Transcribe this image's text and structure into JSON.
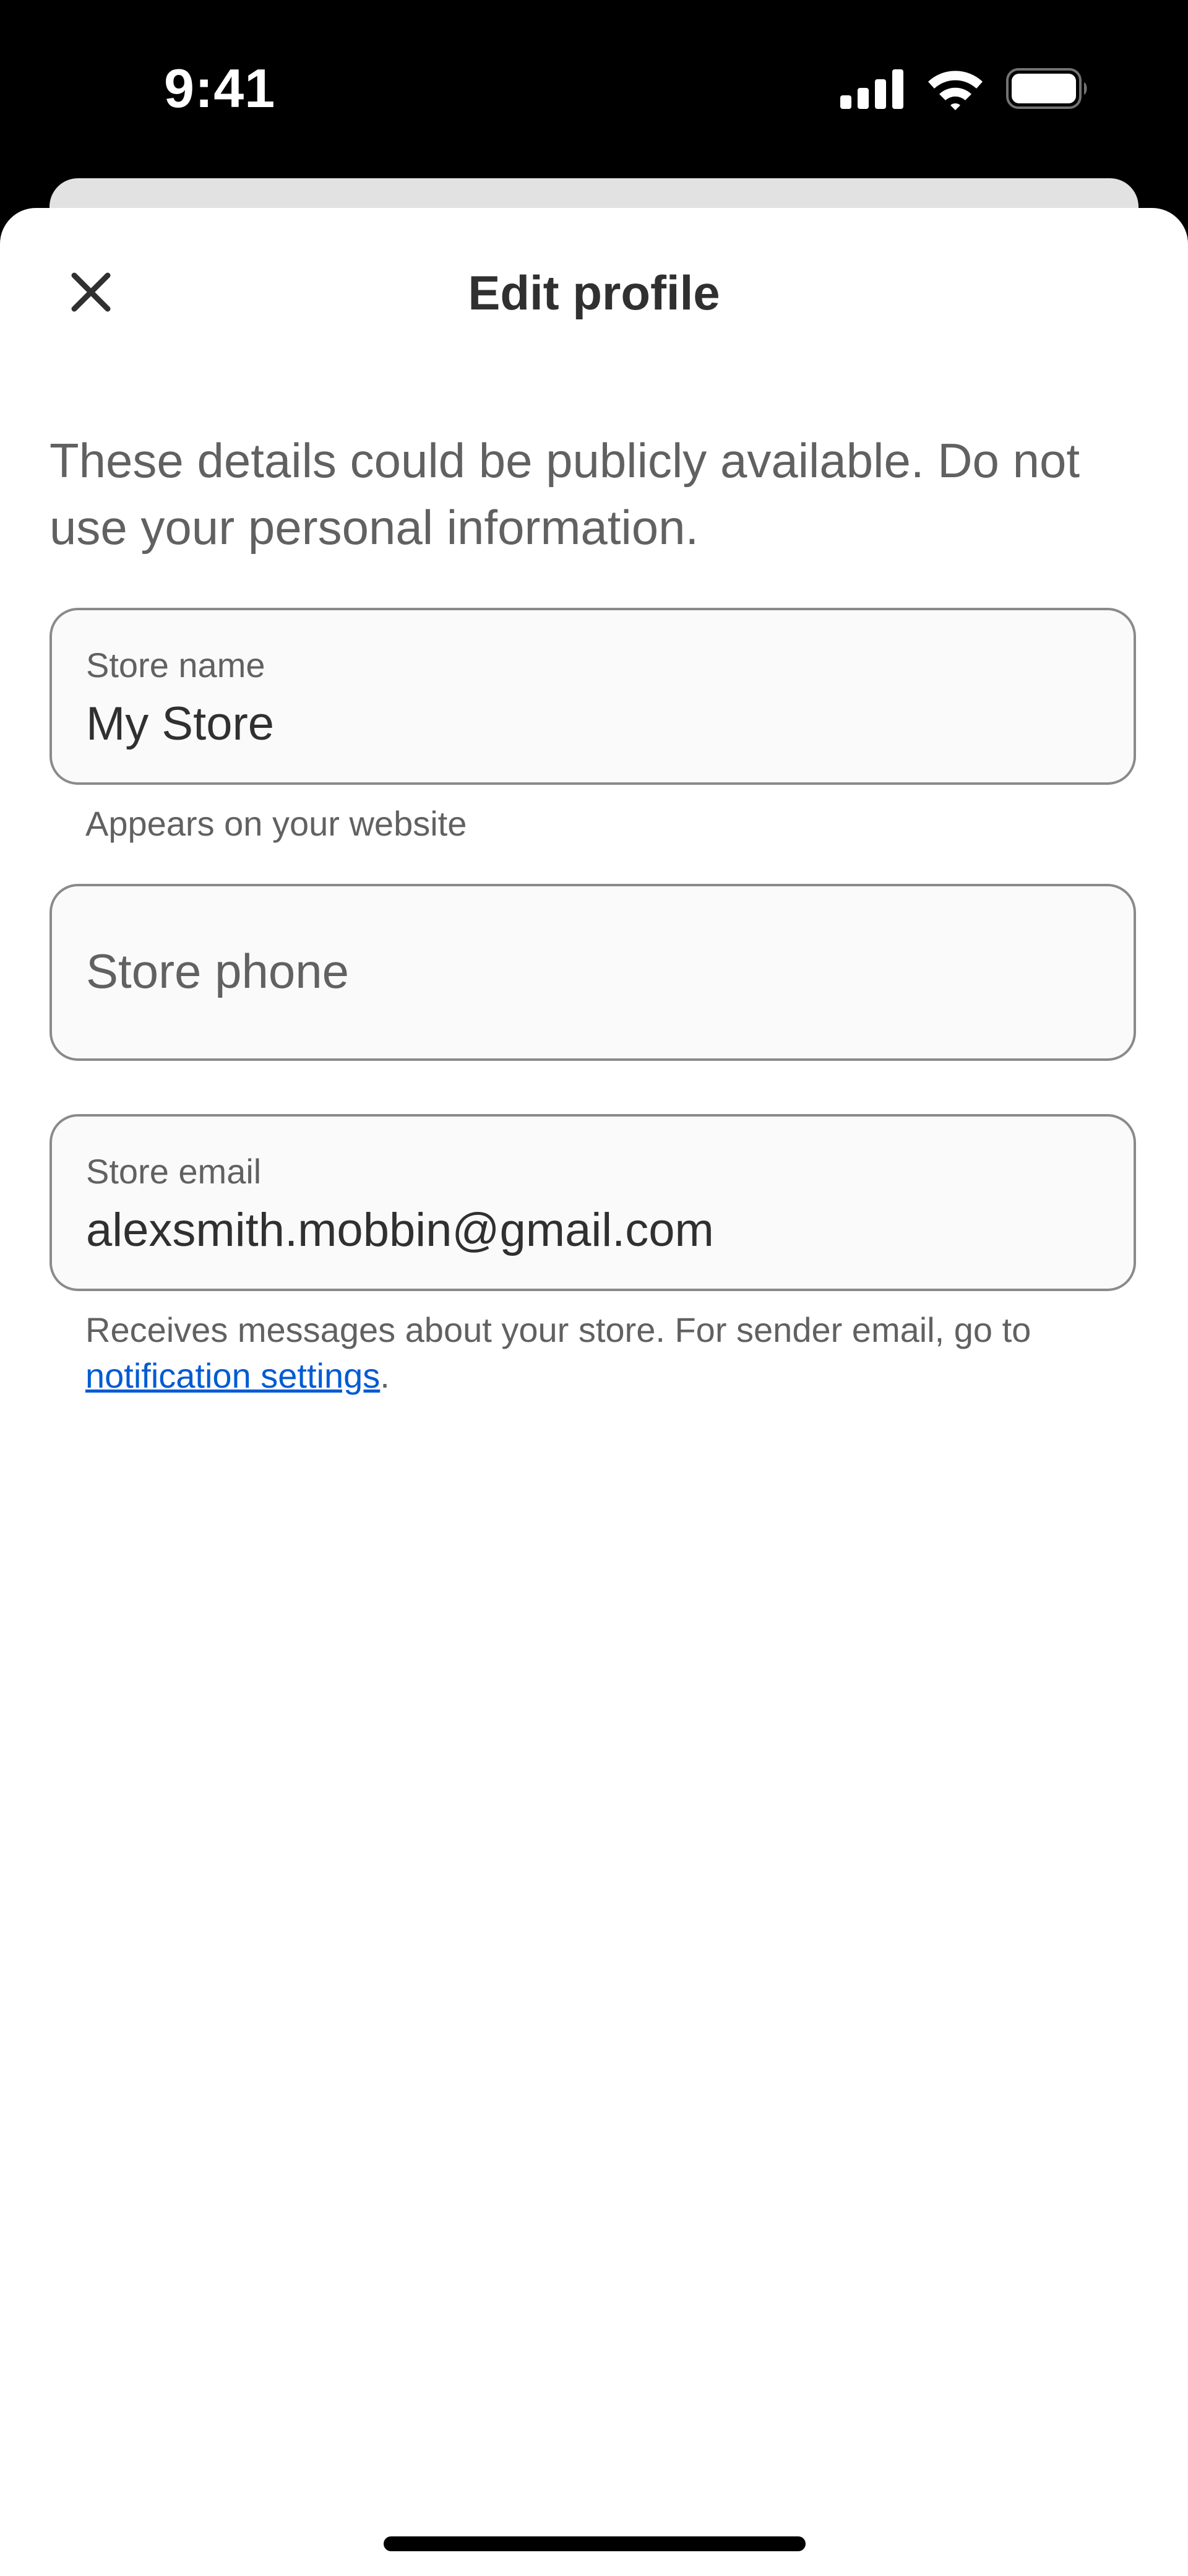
{
  "status_bar": {
    "time": "9:41",
    "icons": [
      "cellular-signal-icon",
      "wifi-icon",
      "battery-icon"
    ]
  },
  "header": {
    "title": "Edit profile",
    "close_icon": "close-icon"
  },
  "intro": {
    "text": "These details could be publicly available. Do not use your personal information."
  },
  "fields": {
    "store_name": {
      "label": "Store name",
      "value": "My Store",
      "help": "Appears on your website"
    },
    "store_phone": {
      "placeholder": "Store phone"
    },
    "store_email": {
      "label": "Store email",
      "value": "alexsmith.mobbin@gmail.com",
      "help_prefix": "Receives messages about your store. For sender email, go to ",
      "help_link": "notification settings",
      "help_suffix": "."
    }
  },
  "colors": {
    "link": "#005bd3",
    "text_primary": "#303030",
    "text_secondary": "#616161",
    "field_border": "#8a8a8a"
  }
}
